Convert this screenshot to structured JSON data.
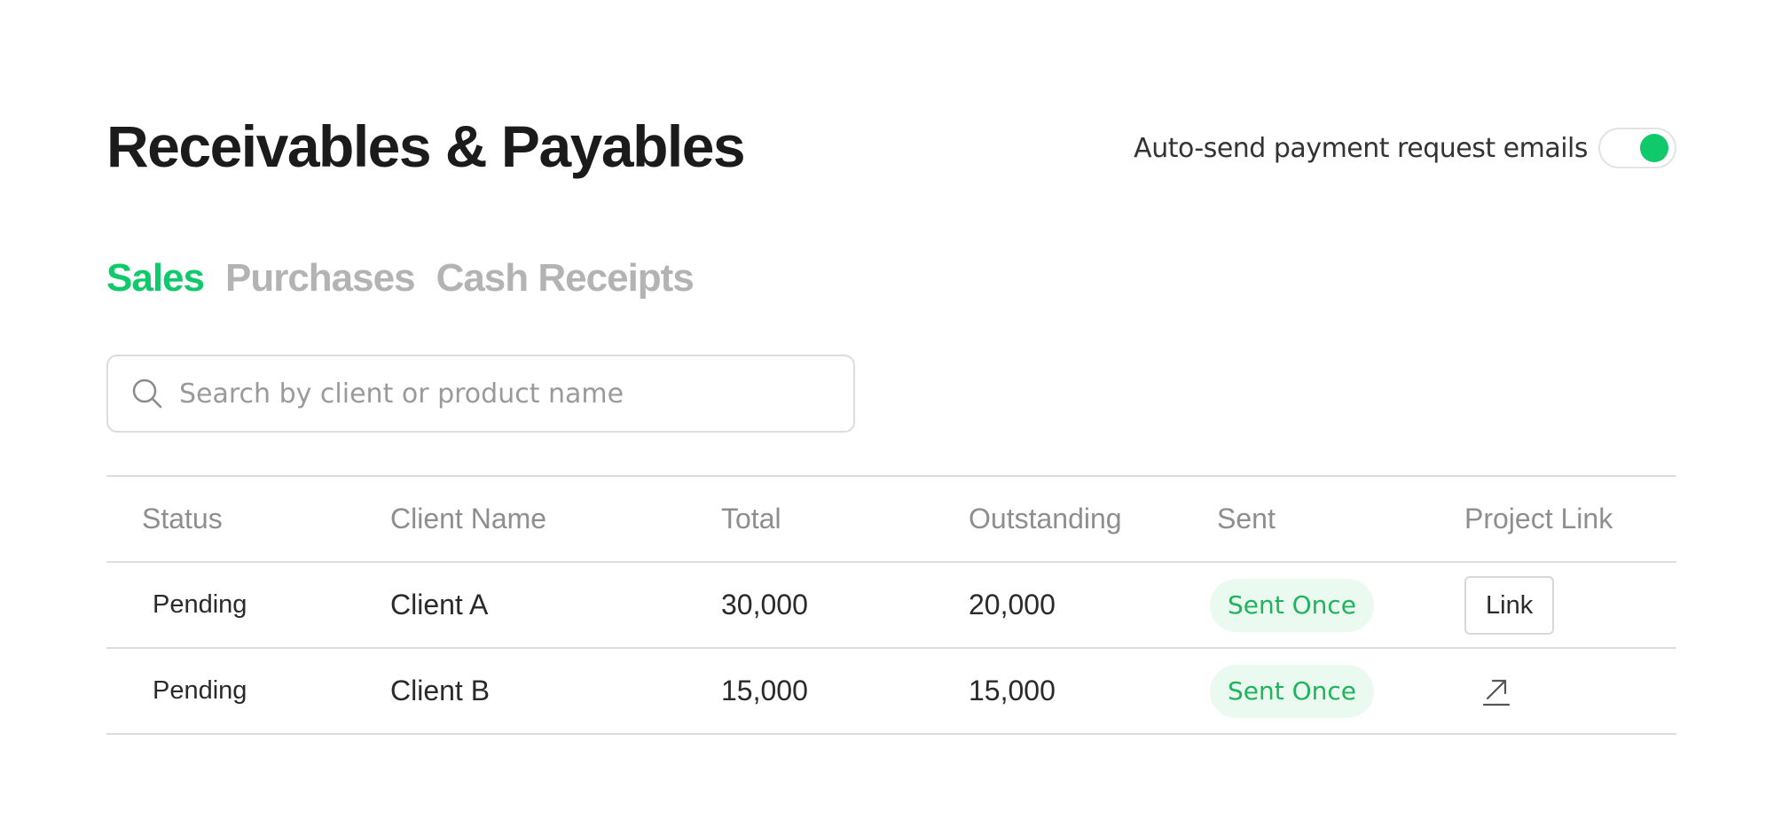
{
  "header": {
    "title": "Receivables & Payables",
    "autosend_label": "Auto-send payment request emails",
    "autosend_on": true
  },
  "tabs": [
    {
      "label": "Sales",
      "active": true
    },
    {
      "label": "Purchases",
      "active": false
    },
    {
      "label": "Cash Receipts",
      "active": false
    }
  ],
  "search": {
    "placeholder": "Search by client or product name",
    "value": "",
    "icon": "search-icon"
  },
  "table": {
    "columns": [
      "Status",
      "Client Name",
      "Total",
      "Outstanding",
      "Sent",
      "Project Link"
    ],
    "rows": [
      {
        "status": "Pending",
        "client": "Client A",
        "total": "30,000",
        "outstanding": "20,000",
        "sent": "Sent Once",
        "project_link": "Link"
      },
      {
        "status": "Pending",
        "client": "Client B",
        "total": "15,000",
        "outstanding": "15,000",
        "sent": "Sent Once",
        "project_link_icon": "external-link-icon"
      }
    ]
  },
  "colors": {
    "accent": "#10c96a",
    "tab_inactive": "#b3b3b3",
    "badge_bg": "#eafaf0",
    "badge_text": "#1fb45c"
  }
}
